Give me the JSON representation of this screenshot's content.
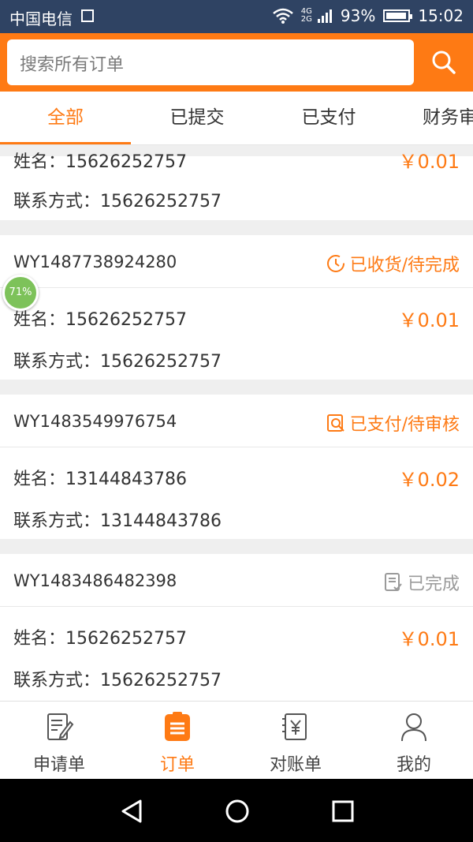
{
  "status_bar": {
    "carrier": "中国电信",
    "network": "4G",
    "network2": "2G",
    "battery_percent": "93%",
    "battery_level": 0.93,
    "time": "15:02"
  },
  "search": {
    "placeholder": "搜索所有订单",
    "icon": "search-icon"
  },
  "tabs": [
    {
      "label": "全部",
      "active": true
    },
    {
      "label": "已提交",
      "active": false
    },
    {
      "label": "已支付",
      "active": false
    },
    {
      "label": "财务审",
      "active": false
    }
  ],
  "orders": [
    {
      "name_label": "姓名：15626252757",
      "contact_label": "联系方式：15626252757",
      "amount": "￥0.01",
      "partial": true
    },
    {
      "order_no": "WY1487738924280",
      "status": "已收货/待完成",
      "status_icon": "clock-icon",
      "status_color": "#fe7a14",
      "name_label": "姓名：15626252757",
      "contact_label": "联系方式：15626252757",
      "amount": "￥0.01"
    },
    {
      "order_no": "WY1483549976754",
      "status": "已支付/待审核",
      "status_icon": "review-icon",
      "status_color": "#fe7a14",
      "name_label": "姓名：13144843786",
      "contact_label": "联系方式：13144843786",
      "amount": "￥0.02"
    },
    {
      "order_no": "WY1483486482398",
      "status": "已完成",
      "status_icon": "checklist-icon",
      "status_color": "#9a9a9a",
      "name_label": "姓名：15626252757",
      "contact_label": "联系方式：15626252757",
      "amount": "￥0.01"
    }
  ],
  "floating_badge": {
    "text": "71%"
  },
  "bottom_nav": [
    {
      "label": "申请单",
      "icon": "form-edit-icon",
      "active": false
    },
    {
      "label": "订单",
      "icon": "order-list-icon",
      "active": true
    },
    {
      "label": "对账单",
      "icon": "statement-icon",
      "active": false
    },
    {
      "label": "我的",
      "icon": "user-icon",
      "active": false
    }
  ],
  "colors": {
    "accent": "#fe7a14",
    "status_bar": "#2f4363",
    "muted": "#9a9a9a"
  }
}
